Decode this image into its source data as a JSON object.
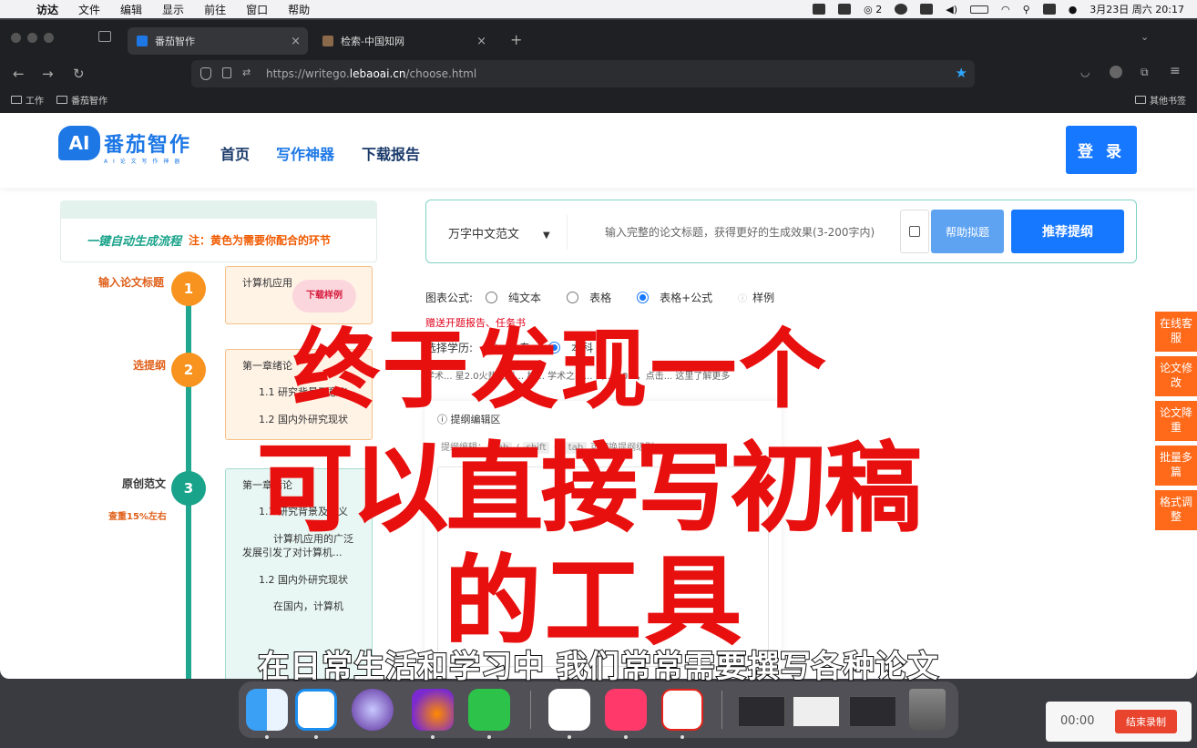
{
  "menubar": {
    "app": "访达",
    "items": [
      "文件",
      "编辑",
      "显示",
      "前往",
      "窗口",
      "帮助"
    ],
    "wechat_count": "2",
    "datetime": "3月23日 周六 20:17"
  },
  "browser": {
    "tabs": [
      {
        "title": "番茄智作"
      },
      {
        "title": "检索-中国知网"
      }
    ],
    "url_prefix": "https://writego.",
    "url_host": "lebaoai.cn",
    "url_path": "/choose.html",
    "bookmarks": [
      "工作",
      "番茄智作"
    ],
    "other_bookmarks": "其他书签"
  },
  "site": {
    "logo_ai": "AI",
    "logo_name": "番茄智作",
    "logo_sub": "A I 论 文 写 作 神 器",
    "nav": [
      "首页",
      "写作神器",
      "下载报告"
    ],
    "login": "登 录"
  },
  "flow": {
    "title": "一键自动生成流程",
    "note": "注：黄色为需要你配合的环节",
    "steps": [
      {
        "num": "1",
        "label": "输入论文标题"
      },
      {
        "num": "2",
        "label": "选提纲"
      },
      {
        "num": "3",
        "label": "原创范文",
        "sub": "查重15%左右"
      }
    ],
    "card1_text": "计算机应用",
    "card1_badge": "下载样例",
    "card2_lines": [
      "第一章绪论",
      "1.1 研究背景及意义",
      "1.2 国内外研究现状"
    ],
    "card3_lines": [
      "第一章绪论",
      "1.1 研究背景及意义",
      "计算机应用的广泛发展引发了对计算机...",
      "1.2 国内外研究现状",
      "在国内，计算机"
    ]
  },
  "form": {
    "type_select": "万字中文范文",
    "title_placeholder": "输入完整的论文标题，获得更好的生成效果(3-200字内)",
    "help_btn": "帮助拟题",
    "recommend_btn": "推荐提纲",
    "chart_label": "图表公式:",
    "chart_options": [
      "纯文本",
      "表格",
      "表格+公式"
    ],
    "chart_selected": "表格+公式",
    "sample": "样例",
    "gift": "赠送开题报告、任务书",
    "edu_label": "选择学历:",
    "edu_options": [
      "大专",
      "本科"
    ],
    "edu_selected": "本科",
    "notice": "学术... 星2.0火热上线... 相... 学术之星... 高... 60%，点击... 这里了解更多",
    "editor_title": "提纲编辑区",
    "editor_hint_prefix": "提纲编辑：",
    "editor_key1": "tab",
    "editor_key2": "shift",
    "editor_key3": "tab",
    "editor_hint_suffix": "可切换提纲级别"
  },
  "side_buttons": [
    "在线客服",
    "论文修改",
    "论文降重",
    "批量多篇",
    "格式调整"
  ],
  "overlay": {
    "line1": "终于发现一个",
    "line2": "可以直接写初稿",
    "line3": "的工具",
    "subtitle": "在日常生活和学习中 我们常常需要撰写各种论文"
  },
  "recorder": {
    "time": "00:00",
    "stop": "结束录制"
  },
  "colors": {
    "brand_blue": "#1677ff",
    "teal": "#21a68f",
    "orange": "#f7931e",
    "side_orange": "#ff6a1a",
    "overlay_red": "#e8100f"
  }
}
